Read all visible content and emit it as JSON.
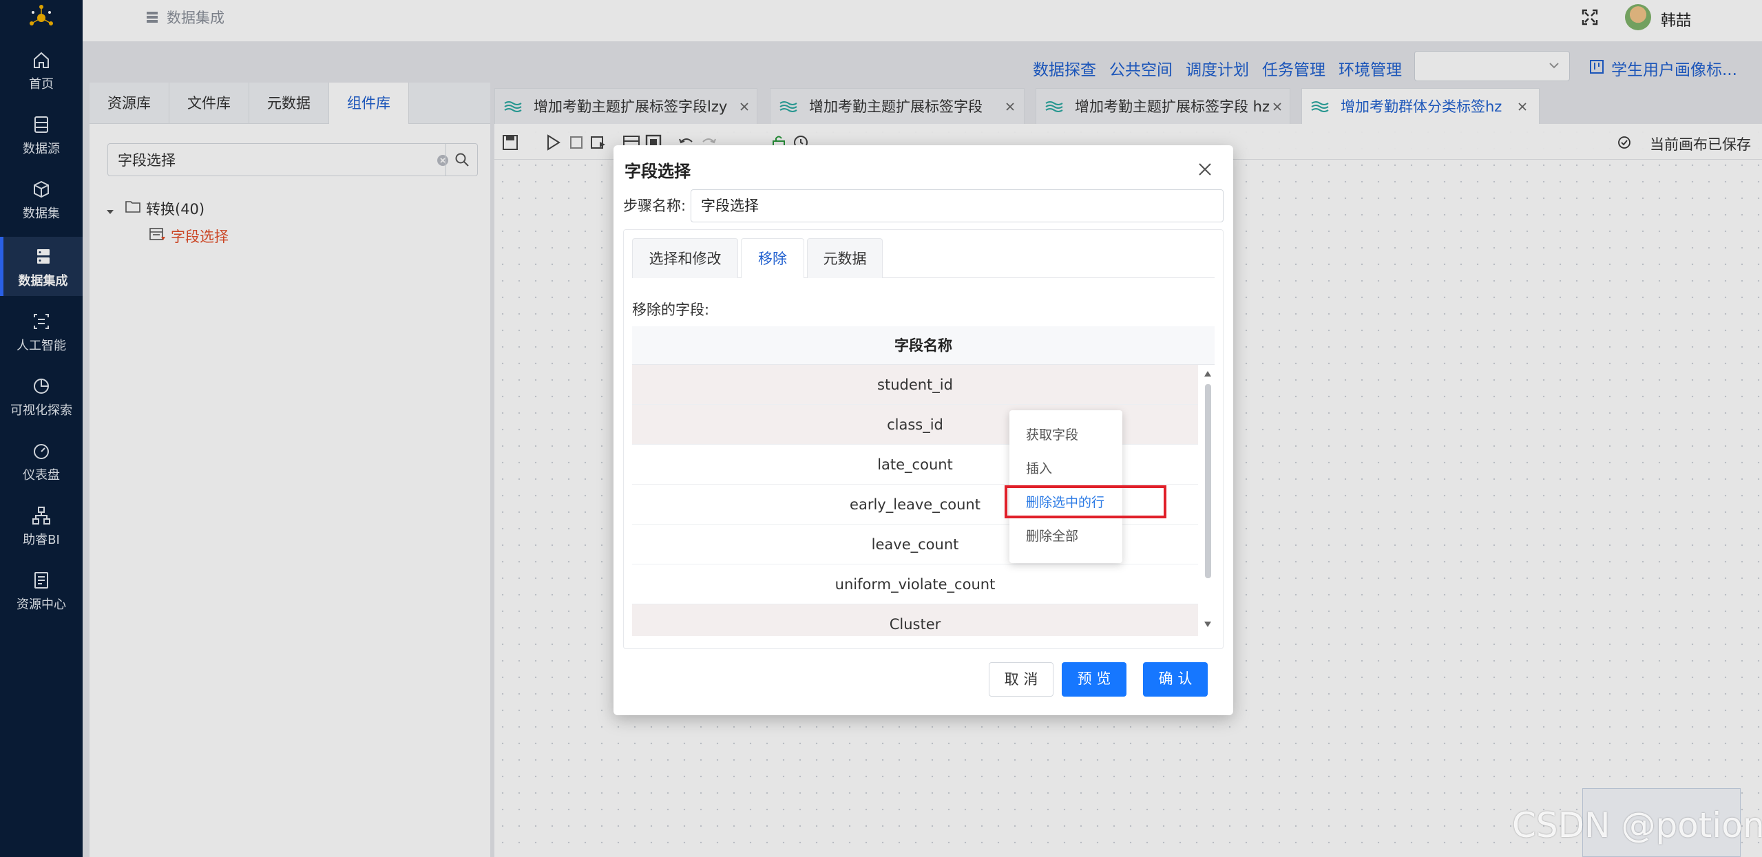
{
  "nav": {
    "items": [
      {
        "label": "首页",
        "icon": "home-icon"
      },
      {
        "label": "数据源",
        "icon": "database-icon"
      },
      {
        "label": "数据集",
        "icon": "cube-icon"
      },
      {
        "label": "数据集成",
        "icon": "server-icon",
        "active": true
      },
      {
        "label": "人工智能",
        "icon": "ai-icon"
      },
      {
        "label": "可视化探索",
        "icon": "pie-chart-icon"
      },
      {
        "label": "仪表盘",
        "icon": "dashboard-icon"
      },
      {
        "label": "助睿BI",
        "icon": "org-chart-icon"
      },
      {
        "label": "资源中心",
        "icon": "resource-icon"
      }
    ]
  },
  "header": {
    "breadcrumb": "数据集成",
    "username": "韩喆"
  },
  "top_links": [
    "数据探查",
    "公共空间",
    "调度计划",
    "任务管理",
    "环境管理"
  ],
  "project_select": {
    "value": ""
  },
  "portrait_link": "学生用户画像标...",
  "left_panel": {
    "tabs": [
      "资源库",
      "文件库",
      "元数据",
      "组件库"
    ],
    "active_tab": "组件库",
    "search_value": "字段选择",
    "tree_root": "转换(40)",
    "tree_leaf": "字段选择"
  },
  "file_tabs": [
    {
      "label": "增加考勤主题扩展标签字段lzy"
    },
    {
      "label": "增加考勤主题扩展标签字段"
    },
    {
      "label": "增加考勤主题扩展标签字段 hz"
    },
    {
      "label": "增加考勤群体分类标签hz",
      "active": true
    }
  ],
  "canvas": {
    "saved_status": "当前画布已保存"
  },
  "dialog": {
    "title": "字段选择",
    "step_label": "步骤名称:",
    "step_value": "字段选择",
    "tabs": [
      "选择和修改",
      "移除",
      "元数据"
    ],
    "active_tab": "移除",
    "removed_label": "移除的字段:",
    "table_header": "字段名称",
    "rows": [
      "student_id",
      "class_id",
      "late_count",
      "early_leave_count",
      "leave_count",
      "uniform_violate_count",
      "Cluster"
    ],
    "cancel": "取 消",
    "preview": "预 览",
    "confirm": "确 认"
  },
  "context_menu": {
    "items": [
      "获取字段",
      "插入",
      "删除选中的行",
      "删除全部"
    ],
    "highlighted": "删除选中的行"
  },
  "watermark": "CSDN @potion()",
  "colors": {
    "nav_bg": "#0b1f3a",
    "primary": "#1677ff",
    "link": "#1f5fcf",
    "highlight_box": "#e0202a",
    "selected_row": "#f3eeee"
  }
}
